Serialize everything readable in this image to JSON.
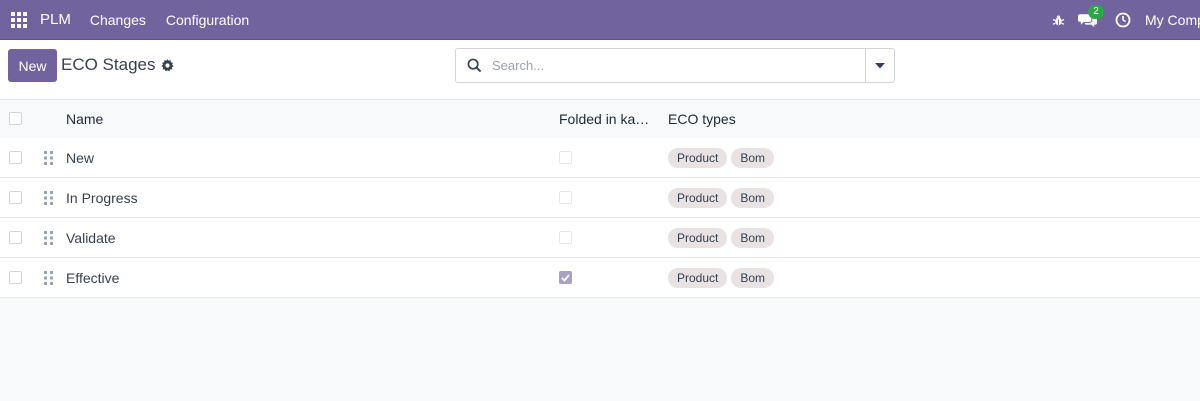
{
  "navbar": {
    "brand": "PLM",
    "menu": [
      "Changes",
      "Configuration"
    ],
    "messages_count": "2",
    "company": "My Company"
  },
  "control_panel": {
    "new_label": "New",
    "title": "ECO Stages",
    "search_placeholder": "Search..."
  },
  "list": {
    "columns": {
      "name": "Name",
      "folded": "Folded in kanban view",
      "eco_types": "ECO types"
    },
    "rows": [
      {
        "name": "New",
        "folded": false,
        "tags": [
          "Product",
          "Bom"
        ]
      },
      {
        "name": "In Progress",
        "folded": false,
        "tags": [
          "Product",
          "Bom"
        ]
      },
      {
        "name": "Validate",
        "folded": false,
        "tags": [
          "Product",
          "Bom"
        ]
      },
      {
        "name": "Effective",
        "folded": true,
        "tags": [
          "Product",
          "Bom"
        ]
      }
    ]
  },
  "colors": {
    "brand": "#71639e",
    "badge": "#28a745",
    "tag_bg": "#e8e2e2"
  }
}
